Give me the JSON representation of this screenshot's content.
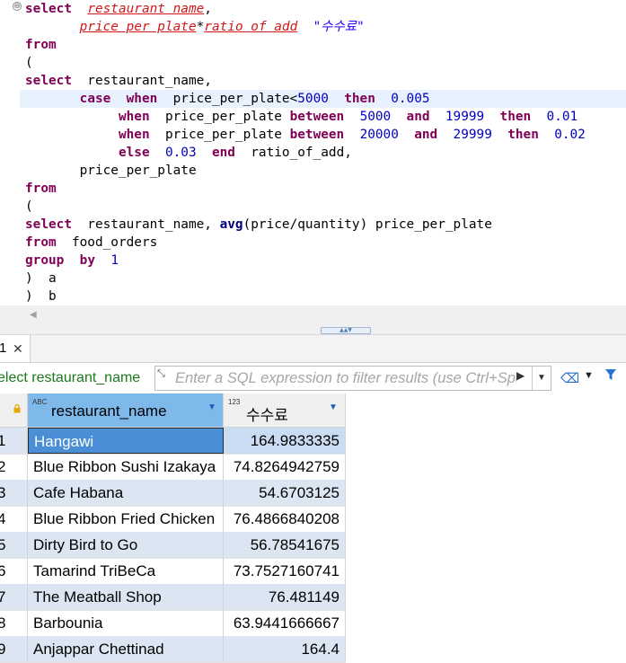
{
  "editor": {
    "lines": [
      [
        [
          "kw",
          "select"
        ],
        [
          "",
          "  "
        ],
        [
          "err",
          "restaurant name"
        ],
        [
          "",
          ","
        ]
      ],
      [
        [
          "",
          "       "
        ],
        [
          "err",
          "price per plate"
        ],
        [
          "",
          "*"
        ],
        [
          "err",
          "ratio of add"
        ],
        [
          "",
          "  "
        ],
        [
          "str",
          "\"수수료\""
        ]
      ],
      [
        [
          "kw",
          "from"
        ]
      ],
      [
        [
          "",
          "("
        ]
      ],
      [
        [
          "kw",
          "select"
        ],
        [
          "",
          "  restaurant_name,"
        ]
      ],
      [
        [
          "",
          "       "
        ],
        [
          "kw",
          "case"
        ],
        [
          "",
          "  "
        ],
        [
          "kw",
          "when"
        ],
        [
          "",
          "  price_per_plate<"
        ],
        [
          "num",
          "5000"
        ],
        [
          "",
          "  "
        ],
        [
          "kw",
          "then"
        ],
        [
          "",
          "  "
        ],
        [
          "num",
          "0.005"
        ]
      ],
      [
        [
          "",
          "            "
        ],
        [
          "kw",
          "when"
        ],
        [
          "",
          "  price_per_plate "
        ],
        [
          "kw",
          "between"
        ],
        [
          "",
          "  "
        ],
        [
          "num",
          "5000"
        ],
        [
          "",
          "  "
        ],
        [
          "kw",
          "and"
        ],
        [
          "",
          "  "
        ],
        [
          "num",
          "19999"
        ],
        [
          "",
          "  "
        ],
        [
          "kw",
          "then"
        ],
        [
          "",
          "  "
        ],
        [
          "num",
          "0.01"
        ]
      ],
      [
        [
          "",
          "            "
        ],
        [
          "kw",
          "when"
        ],
        [
          "",
          "  price_per_plate "
        ],
        [
          "kw",
          "between"
        ],
        [
          "",
          "  "
        ],
        [
          "num",
          "20000"
        ],
        [
          "",
          "  "
        ],
        [
          "kw",
          "and"
        ],
        [
          "",
          "  "
        ],
        [
          "num",
          "29999"
        ],
        [
          "",
          "  "
        ],
        [
          "kw",
          "then"
        ],
        [
          "",
          "  "
        ],
        [
          "num",
          "0.02"
        ]
      ],
      [
        [
          "",
          "            "
        ],
        [
          "kw",
          "else"
        ],
        [
          "",
          "  "
        ],
        [
          "num",
          "0.03"
        ],
        [
          "",
          "  "
        ],
        [
          "kw",
          "end"
        ],
        [
          "",
          "  ratio_of_add,"
        ]
      ],
      [
        [
          "",
          "       price_per_plate"
        ]
      ],
      [
        [
          "kw",
          "from"
        ]
      ],
      [
        [
          "",
          "("
        ]
      ],
      [
        [
          "kw",
          "select"
        ],
        [
          "",
          "  restaurant_name, "
        ],
        [
          "kw2",
          "avg"
        ],
        [
          "",
          "(price/quantity) price_per_plate"
        ]
      ],
      [
        [
          "kw",
          "from"
        ],
        [
          "",
          "  food_orders"
        ]
      ],
      [
        [
          "kw",
          "group"
        ],
        [
          "",
          "  "
        ],
        [
          "kw",
          "by"
        ],
        [
          "",
          "  "
        ],
        [
          "num",
          "1"
        ]
      ],
      [
        [
          "",
          ")  a"
        ]
      ],
      [
        [
          "",
          ")  b"
        ]
      ]
    ],
    "current_line": 5,
    "fold_marker": "⊖"
  },
  "splitter": {
    "glyph": "▲▲▼"
  },
  "hscroll": {
    "left_arrow": "◀"
  },
  "result_tab": {
    "label": "1",
    "close": "✕"
  },
  "filter": {
    "query_text": "elect restaurant_name",
    "placeholder": "Enter a SQL expression to filter results (use Ctrl+Space)",
    "autocomplete_icon": "⤡",
    "run_icon": "▶",
    "history_icon": "▼",
    "eraser_icon": "⌫",
    "dropdown_icon": "▼",
    "funnel_icon": "Y",
    "extra_icon": "⋮"
  },
  "grid": {
    "lock_icon": "🔒",
    "columns": [
      {
        "type_tag": "ABC",
        "name": "restaurant_name",
        "sort": "▼"
      },
      {
        "type_tag": "123",
        "name": "수수료",
        "sort": "▼"
      }
    ],
    "rows": [
      {
        "num": "1",
        "name": "Hangawi",
        "fee": "164.9833335"
      },
      {
        "num": "2",
        "name": "Blue Ribbon Sushi Izakaya",
        "fee": "74.8264942759"
      },
      {
        "num": "3",
        "name": "Cafe Habana",
        "fee": "54.6703125"
      },
      {
        "num": "4",
        "name": "Blue Ribbon Fried Chicken",
        "fee": "76.4866840208"
      },
      {
        "num": "5",
        "name": "Dirty Bird to Go",
        "fee": "56.78541675"
      },
      {
        "num": "6",
        "name": "Tamarind TriBeCa",
        "fee": "73.7527160741"
      },
      {
        "num": "7",
        "name": "The Meatball Shop",
        "fee": "76.481149"
      },
      {
        "num": "8",
        "name": "Barbounia",
        "fee": "63.9441666667"
      },
      {
        "num": "9",
        "name": "Anjappar Chettinad",
        "fee": "164.4"
      }
    ],
    "selected_row": 0
  }
}
